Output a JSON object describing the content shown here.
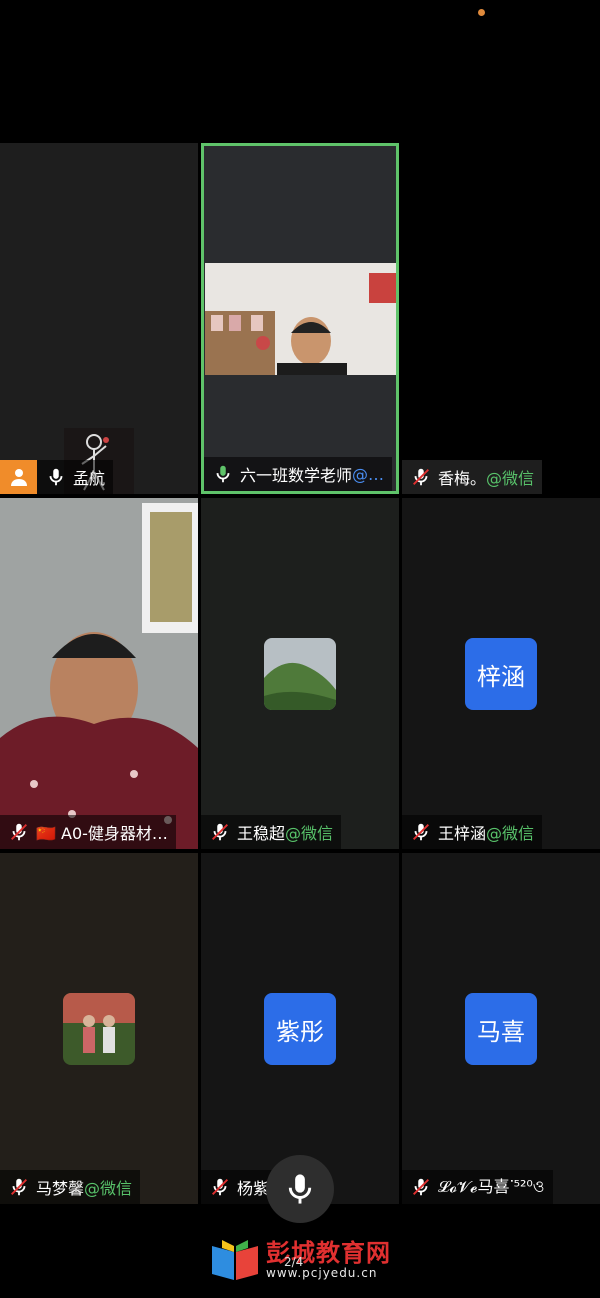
{
  "participants": [
    {
      "name": "孟航",
      "suffix": "",
      "avatar": "stick-figure-drawing",
      "host": true,
      "muted": false
    },
    {
      "name": "六一班数学老师",
      "suffix": "@…",
      "avatar": "camera-video",
      "host": false,
      "muted": false,
      "speaking": true
    },
    {
      "name": "香梅。",
      "suffix": "@微信",
      "avatar": "",
      "host": false,
      "muted": true
    },
    {
      "name": "🇨🇳 A0-健身器材…",
      "suffix": "",
      "avatar": "camera-video",
      "host": false,
      "muted": true
    },
    {
      "name": "王稳超",
      "suffix": "@微信",
      "avatar": "mountain-photo",
      "host": false,
      "muted": true
    },
    {
      "name": "王梓涵",
      "suffix": "@微信",
      "avatar_text": "梓涵",
      "host": false,
      "muted": true
    },
    {
      "name": "马梦馨",
      "suffix": "@微信",
      "avatar": "group-photo",
      "host": false,
      "muted": true
    },
    {
      "name": "杨紫",
      "suffix": "",
      "avatar_text": "紫彤",
      "host": false,
      "muted": true
    },
    {
      "name": "𝓛𝓸𝓥𝓮马喜ᐝ⁵²⁰ও",
      "suffix": "",
      "avatar_text": "马喜",
      "host": false,
      "muted": true
    }
  ],
  "page_indicator": "2/4",
  "watermark": {
    "title": "彭城教育网",
    "url": "www.pcjyedu.cn"
  },
  "colors": {
    "accent": "#2c6de8",
    "speaking_border": "#5fc36a",
    "host_badge": "#f08c2a",
    "wechat": "#58c26a"
  }
}
